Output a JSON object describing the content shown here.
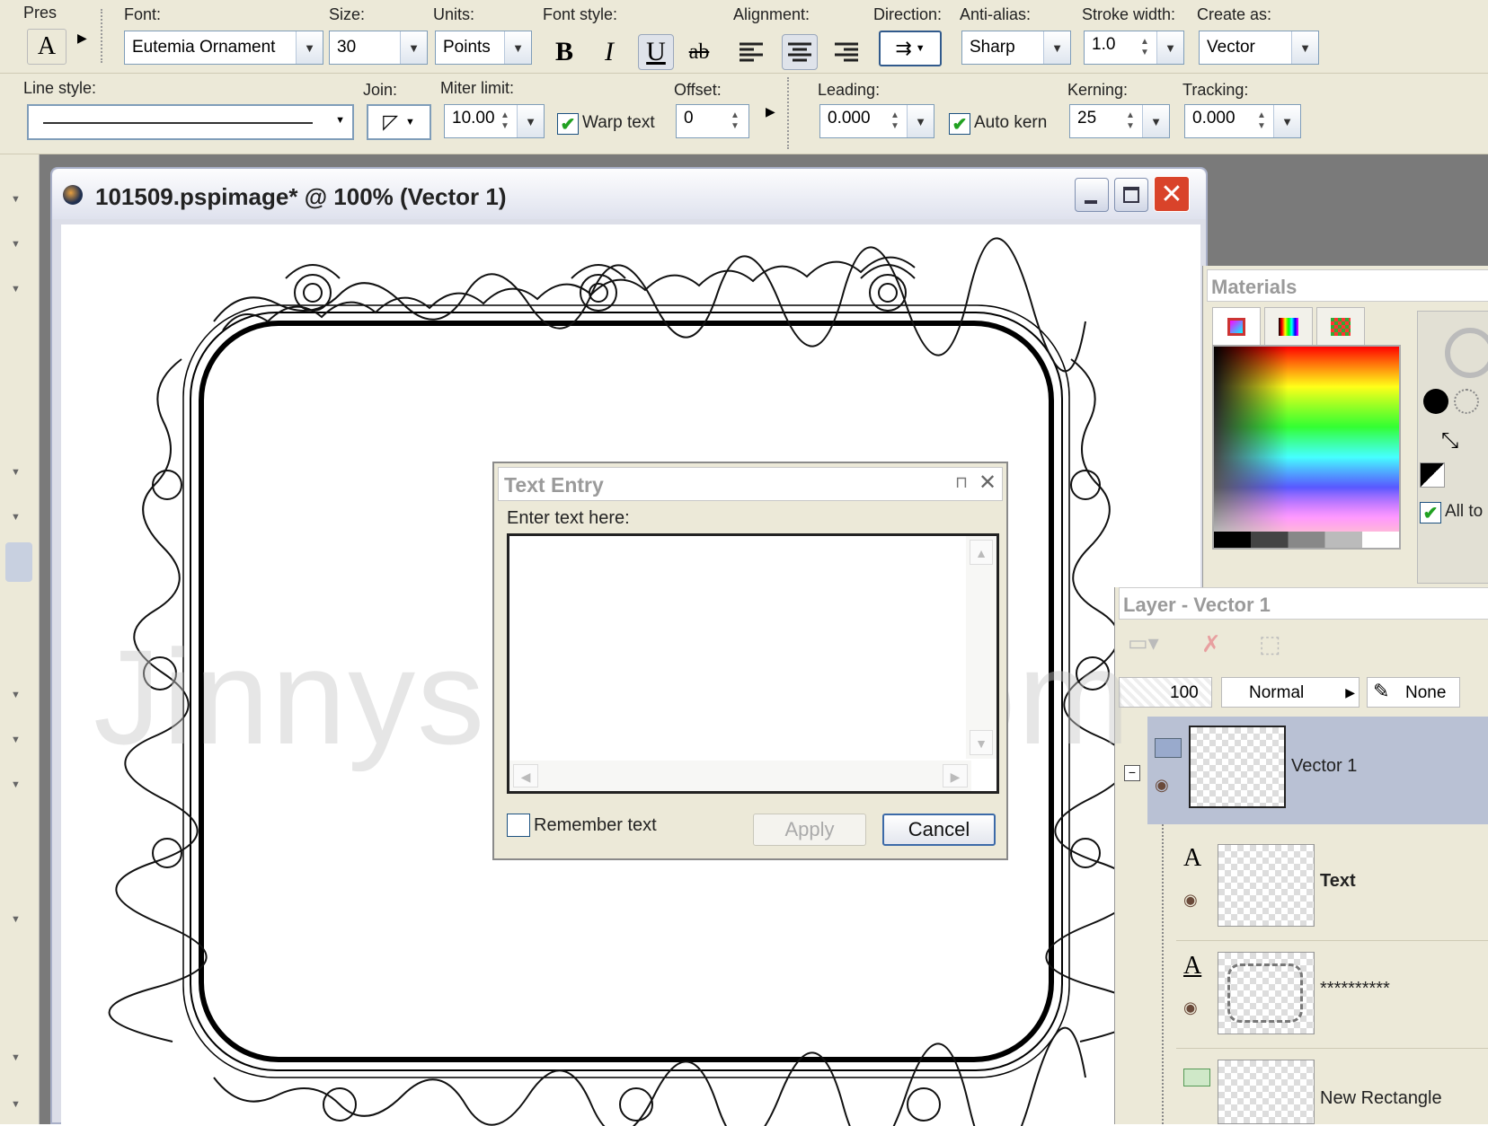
{
  "toolbar1": {
    "presets_label": "Pres",
    "font_label": "Font:",
    "font_value": "Eutemia Ornament",
    "size_label": "Size:",
    "size_value": "30",
    "units_label": "Units:",
    "units_value": "Points",
    "fontstyle_label": "Font style:",
    "bold": "B",
    "italic": "I",
    "underline": "U",
    "strike": "ab",
    "alignment_label": "Alignment:",
    "direction_label": "Direction:",
    "antialias_label": "Anti-alias:",
    "antialias_value": "Sharp",
    "stroke_label": "Stroke width:",
    "stroke_value": "1.0",
    "createas_label": "Create as:",
    "createas_value": "Vector"
  },
  "toolbar2": {
    "linestyle_label": "Line style:",
    "join_label": "Join:",
    "miter_label": "Miter limit:",
    "miter_value": "10.00",
    "warp_label": "Warp text",
    "offset_label": "Offset:",
    "offset_value": "0",
    "leading_label": "Leading:",
    "leading_value": "0.000",
    "autokern_label": "Auto kern",
    "kerning_label": "Kerning:",
    "kerning_value": "25",
    "tracking_label": "Tracking:",
    "tracking_value": "0.000"
  },
  "document": {
    "title": "101509.pspimage* @ 100% (Vector 1)",
    "watermark": "JinnysPlace.com"
  },
  "dialog": {
    "title": "Text Entry",
    "prompt": "Enter text here:",
    "text_value": "",
    "remember_label": "Remember text",
    "apply_label": "Apply",
    "cancel_label": "Cancel"
  },
  "materials": {
    "title": "Materials",
    "all_tools_label": "All to"
  },
  "layers": {
    "title": "Layer - Vector 1",
    "opacity": "100",
    "blend": "Normal",
    "mask": "None",
    "items": [
      {
        "name": "Vector 1",
        "kind": "vector-group"
      },
      {
        "name": "Text",
        "kind": "text"
      },
      {
        "name": "**********",
        "kind": "text"
      },
      {
        "name": "New Rectangle",
        "kind": "shape"
      }
    ]
  },
  "colors": {
    "accent": "#7f9db9",
    "close_red": "#d9432a",
    "selected_layer": "#b9c1d4",
    "checkmark": "#21a121"
  }
}
